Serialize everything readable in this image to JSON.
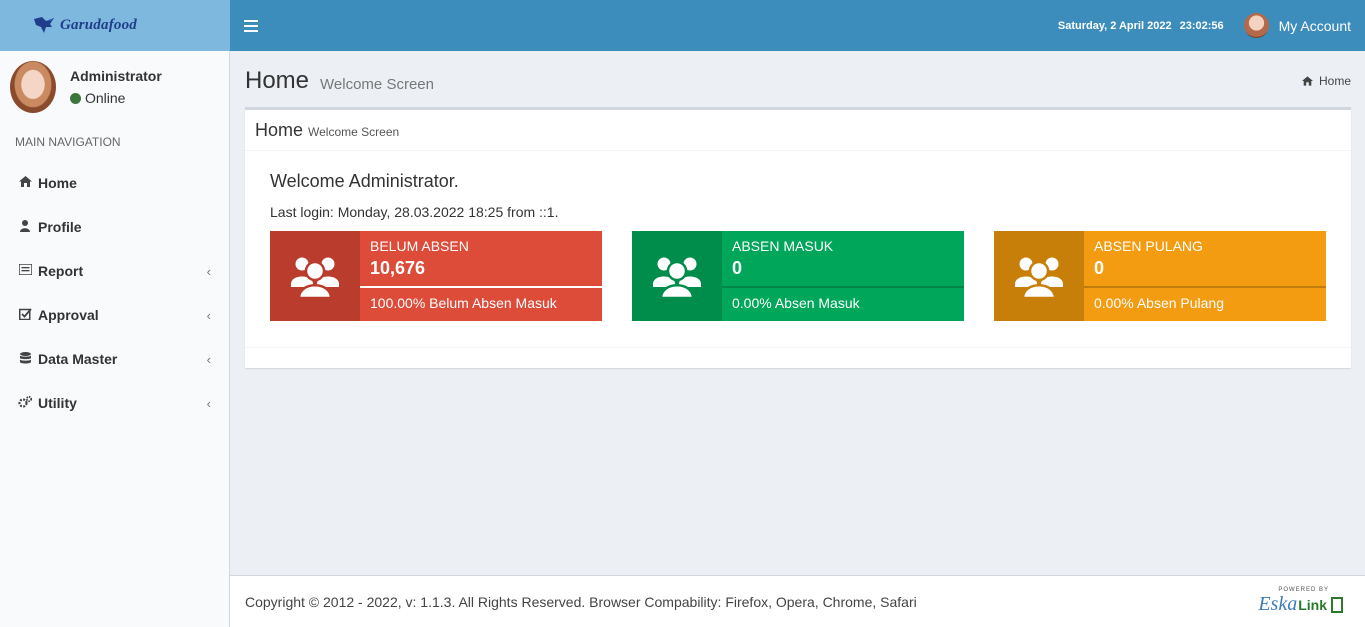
{
  "brand": {
    "logo_text": "Garudafood"
  },
  "topbar": {
    "date": "Saturday, 2 April 2022",
    "time": "23:02:56",
    "account_label": "My Account"
  },
  "user": {
    "name": "Administrator",
    "status": "Online"
  },
  "sidebar": {
    "header": "MAIN NAVIGATION",
    "items": [
      {
        "label": "Home",
        "icon": "home-icon"
      },
      {
        "label": "Profile",
        "icon": "user-icon"
      },
      {
        "label": "Report",
        "icon": "list-icon"
      },
      {
        "label": "Approval",
        "icon": "check-square-icon"
      },
      {
        "label": "Data Master",
        "icon": "database-icon"
      },
      {
        "label": "Utility",
        "icon": "gears-icon"
      }
    ]
  },
  "content_header": {
    "title": "Home",
    "subtitle": "Welcome Screen",
    "breadcrumb": "Home"
  },
  "box": {
    "title": "Home",
    "subtitle": "Welcome Screen",
    "welcome": "Welcome Administrator.",
    "last_login": "Last login: Monday, 28.03.2022 18:25 from ::1."
  },
  "info_boxes": [
    {
      "label": "BELUM ABSEN",
      "value": "10,676",
      "progress_percent": 100,
      "description": "100.00% Belum Absen Masuk",
      "color": "#dd4b39"
    },
    {
      "label": "ABSEN MASUK",
      "value": "0",
      "progress_percent": 0,
      "description": "0.00% Absen Masuk",
      "color": "#00a65a"
    },
    {
      "label": "ABSEN PULANG",
      "value": "0",
      "progress_percent": 0,
      "description": "0.00% Absen Pulang",
      "color": "#f39c12"
    }
  ],
  "footer": {
    "text": "Copyright © 2012 - 2022, v: 1.1.3. All Rights Reserved. Browser Compability: Firefox, Opera, Chrome, Safari",
    "powered_by": "POWERED BY",
    "brand_a": "Eska",
    "brand_b": "Link"
  }
}
